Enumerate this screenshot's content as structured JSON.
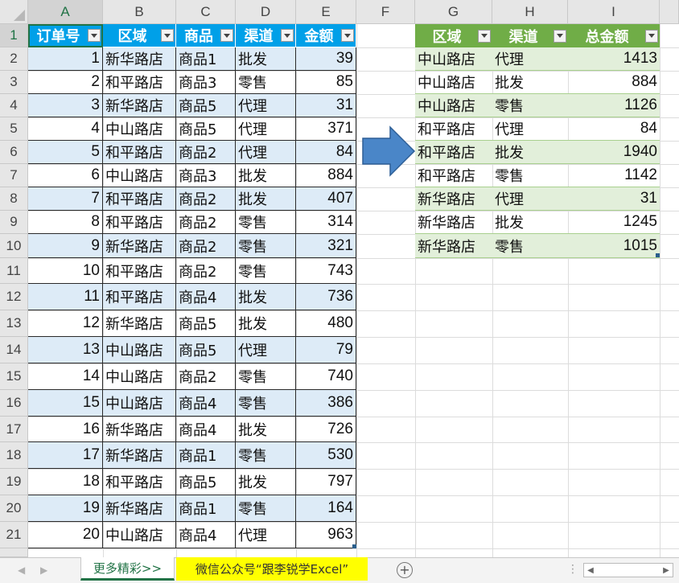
{
  "sheet": {
    "columns": [
      "A",
      "B",
      "C",
      "D",
      "E",
      "F",
      "G",
      "H",
      "I"
    ],
    "rows": [
      "1",
      "2",
      "3",
      "4",
      "5",
      "6",
      "7",
      "8",
      "9",
      "10",
      "11",
      "12",
      "13",
      "14",
      "15",
      "16",
      "17",
      "18",
      "19",
      "20",
      "21"
    ]
  },
  "table1": {
    "headers": [
      "订单号",
      "区域",
      "商品",
      "渠道",
      "金额"
    ],
    "rows": [
      [
        "1",
        "新华路店",
        "商品1",
        "批发",
        "39"
      ],
      [
        "2",
        "和平路店",
        "商品3",
        "零售",
        "85"
      ],
      [
        "3",
        "新华路店",
        "商品5",
        "代理",
        "31"
      ],
      [
        "4",
        "中山路店",
        "商品5",
        "代理",
        "371"
      ],
      [
        "5",
        "和平路店",
        "商品2",
        "代理",
        "84"
      ],
      [
        "6",
        "中山路店",
        "商品3",
        "批发",
        "884"
      ],
      [
        "7",
        "和平路店",
        "商品2",
        "批发",
        "407"
      ],
      [
        "8",
        "和平路店",
        "商品2",
        "零售",
        "314"
      ],
      [
        "9",
        "新华路店",
        "商品2",
        "零售",
        "321"
      ],
      [
        "10",
        "和平路店",
        "商品2",
        "零售",
        "743"
      ],
      [
        "11",
        "和平路店",
        "商品4",
        "批发",
        "736"
      ],
      [
        "12",
        "新华路店",
        "商品5",
        "批发",
        "480"
      ],
      [
        "13",
        "中山路店",
        "商品5",
        "代理",
        "79"
      ],
      [
        "14",
        "中山路店",
        "商品2",
        "零售",
        "740"
      ],
      [
        "15",
        "中山路店",
        "商品4",
        "零售",
        "386"
      ],
      [
        "16",
        "新华路店",
        "商品4",
        "批发",
        "726"
      ],
      [
        "17",
        "新华路店",
        "商品1",
        "零售",
        "530"
      ],
      [
        "18",
        "和平路店",
        "商品5",
        "批发",
        "797"
      ],
      [
        "19",
        "新华路店",
        "商品1",
        "零售",
        "164"
      ],
      [
        "20",
        "中山路店",
        "商品4",
        "代理",
        "963"
      ]
    ]
  },
  "table2": {
    "headers": [
      "区域",
      "渠道",
      "总金额"
    ],
    "rows": [
      [
        "中山路店",
        "代理",
        "1413"
      ],
      [
        "中山路店",
        "批发",
        "884"
      ],
      [
        "中山路店",
        "零售",
        "1126"
      ],
      [
        "和平路店",
        "代理",
        "84"
      ],
      [
        "和平路店",
        "批发",
        "1940"
      ],
      [
        "和平路店",
        "零售",
        "1142"
      ],
      [
        "新华路店",
        "代理",
        "31"
      ],
      [
        "新华路店",
        "批发",
        "1245"
      ],
      [
        "新华路店",
        "零售",
        "1015"
      ]
    ]
  },
  "tabs": {
    "active": "更多精彩>>",
    "second": "微信公众号“跟李锐学Excel”",
    "add_icon": "plus-circle-icon"
  },
  "colors": {
    "table1_header": "#00a0e8",
    "table1_band": "#ddebf7",
    "table2_header": "#70ad47",
    "table2_band": "#e2efda",
    "arrow": "#4a86c8",
    "tab_highlight": "#ffff00",
    "excel_green": "#217346"
  }
}
